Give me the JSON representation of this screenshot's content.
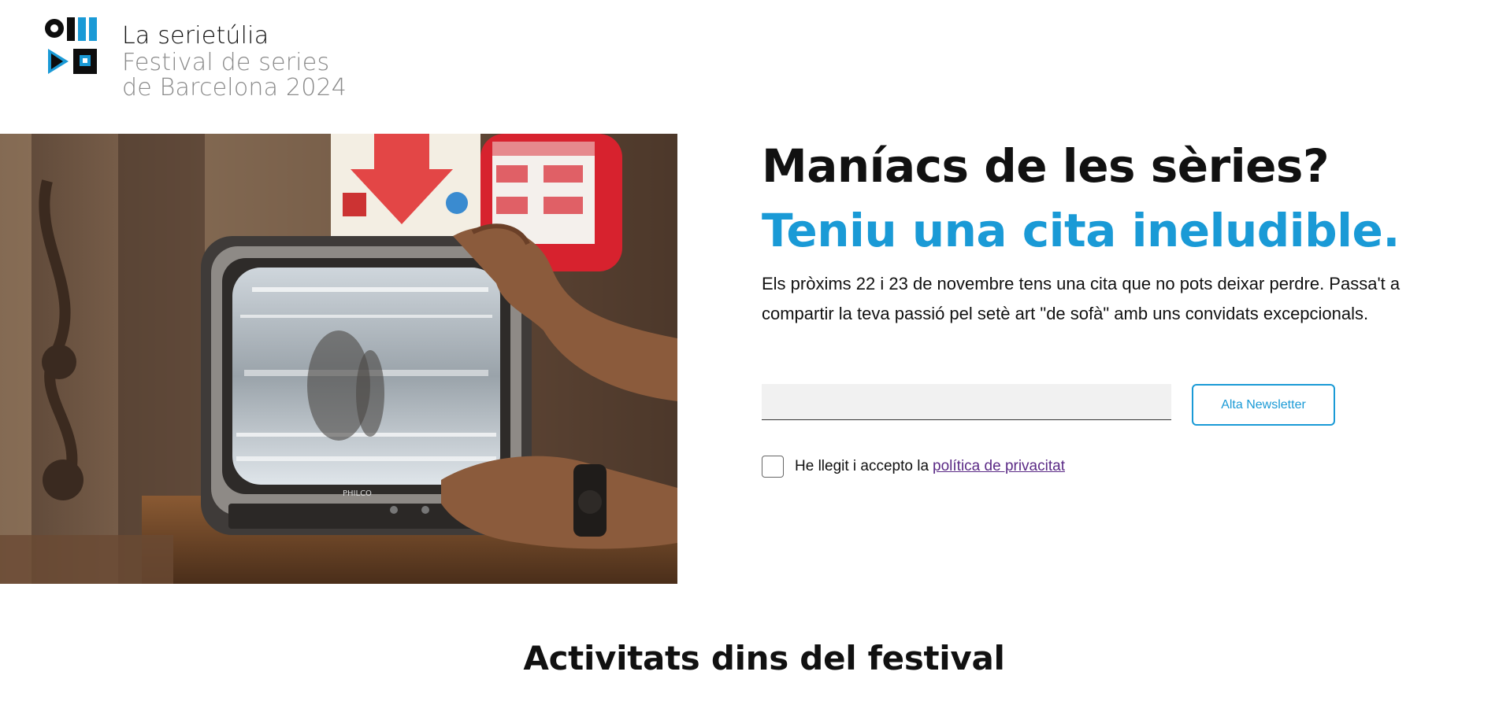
{
  "brand": {
    "title": "La serietúlia",
    "subtitle_line1": "Festival de series",
    "subtitle_line2": "de Barcelona 2024",
    "accent_color": "#1a9ad6"
  },
  "hero": {
    "image_alt": "Hands holding an old Philco TV",
    "tv_brand": "PHILCO",
    "headline_part1": "Maníacs de les sèries?",
    "headline_part2": "Teniu una cita ineludible.",
    "intro": "Els pròxims 22 i 23 de novembre tens una cita que no pots deixar perdre. Passa't a compartir la teva passió pel setè art \"de sofà\" amb uns convidats excepcionals."
  },
  "newsletter": {
    "email_placeholder": "",
    "button_label": "Alta Newsletter",
    "consent_text": "He llegit i accepto la",
    "consent_link": "política de privacitat",
    "checked": false
  },
  "activities": {
    "title": "Activitats dins del festival"
  }
}
